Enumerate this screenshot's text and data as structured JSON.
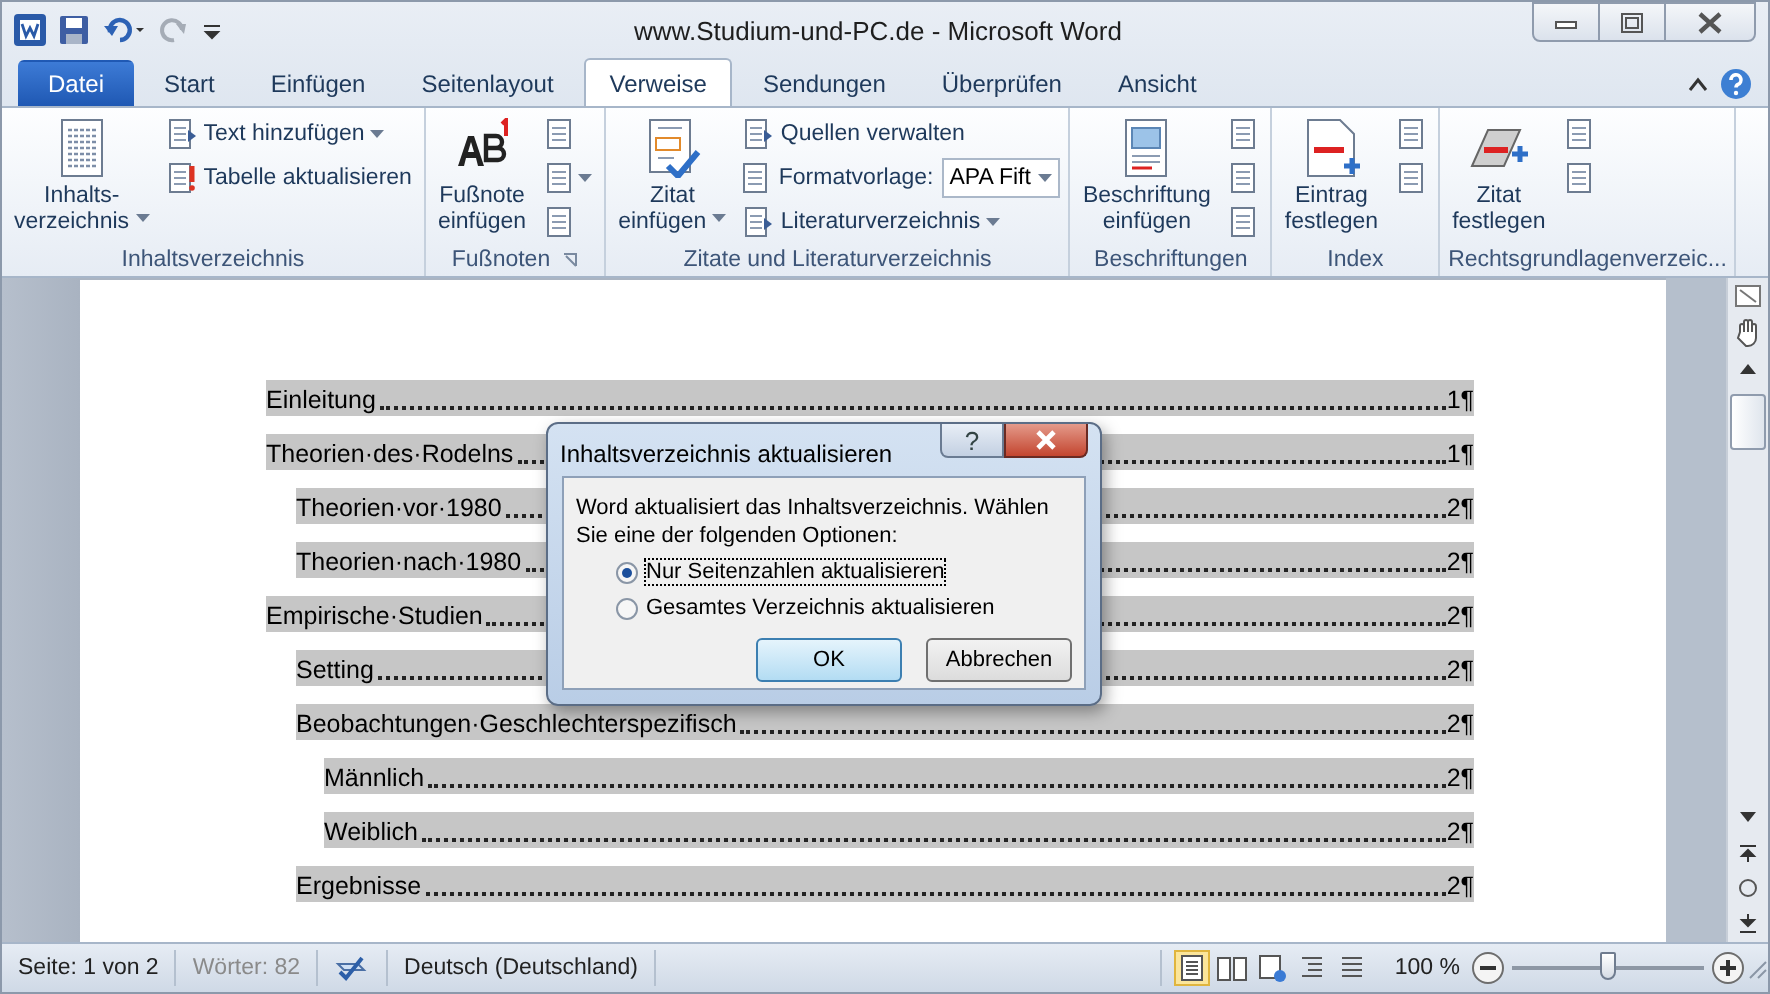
{
  "window": {
    "title": "www.Studium-und-PC.de - Microsoft Word"
  },
  "tabs": [
    {
      "label": "Datei",
      "kind": "file",
      "selected": false
    },
    {
      "label": "Start",
      "kind": "tab",
      "selected": false
    },
    {
      "label": "Einfügen",
      "kind": "tab",
      "selected": false
    },
    {
      "label": "Seitenlayout",
      "kind": "tab",
      "selected": false
    },
    {
      "label": "Verweise",
      "kind": "tab",
      "selected": true
    },
    {
      "label": "Sendungen",
      "kind": "tab",
      "selected": false
    },
    {
      "label": "Überprüfen",
      "kind": "tab",
      "selected": false
    },
    {
      "label": "Ansicht",
      "kind": "tab",
      "selected": false
    }
  ],
  "ribbon_groups": [
    {
      "label": "Inhaltsverzeichnis",
      "launcher": false,
      "columns": [
        {
          "kind": "large",
          "lines": [
            "Inhalts-",
            "verzeichnis"
          ],
          "dropdown": true
        },
        {
          "kind": "stack",
          "items": [
            {
              "kind": "small",
              "label": "Text hinzufügen",
              "dropdown": true
            },
            {
              "kind": "small",
              "label": "Tabelle aktualisieren",
              "dropdown": false
            }
          ]
        }
      ]
    },
    {
      "label": "Fußnoten",
      "launcher": true,
      "columns": [
        {
          "kind": "large",
          "lines": [
            "Fußnote",
            "einfügen"
          ],
          "dropdown": false
        },
        {
          "kind": "stack",
          "items": [
            {
              "kind": "icon",
              "dropdown": false
            },
            {
              "kind": "icon",
              "dropdown": true
            },
            {
              "kind": "icon",
              "dropdown": false
            }
          ]
        }
      ]
    },
    {
      "label": "Zitate und Literaturverzeichnis",
      "launcher": false,
      "columns": [
        {
          "kind": "large",
          "lines": [
            "Zitat",
            "einfügen"
          ],
          "dropdown": true
        },
        {
          "kind": "stack",
          "items": [
            {
              "kind": "small",
              "label": "Quellen verwalten",
              "dropdown": false
            },
            {
              "kind": "combo",
              "label": "Formatvorlage:",
              "value": "APA Fift"
            },
            {
              "kind": "small",
              "label": "Literaturverzeichnis",
              "dropdown": true
            }
          ]
        }
      ]
    },
    {
      "label": "Beschriftungen",
      "launcher": false,
      "columns": [
        {
          "kind": "large",
          "lines": [
            "Beschriftung",
            "einfügen"
          ],
          "dropdown": false
        },
        {
          "kind": "stack",
          "items": [
            {
              "kind": "icon",
              "dropdown": false
            },
            {
              "kind": "icon",
              "dropdown": false
            },
            {
              "kind": "icon",
              "dropdown": false
            }
          ]
        }
      ]
    },
    {
      "label": "Index",
      "launcher": false,
      "columns": [
        {
          "kind": "large",
          "lines": [
            "Eintrag",
            "festlegen"
          ],
          "dropdown": false
        },
        {
          "kind": "stack",
          "items": [
            {
              "kind": "icon",
              "dropdown": false
            },
            {
              "kind": "icon",
              "dropdown": false
            }
          ]
        }
      ]
    },
    {
      "label": "Rechtsgrundlagenverzeic...",
      "launcher": false,
      "columns": [
        {
          "kind": "large",
          "lines": [
            "Zitat",
            "festlegen"
          ],
          "dropdown": false
        },
        {
          "kind": "stack",
          "items": [
            {
              "kind": "icon",
              "dropdown": false
            },
            {
              "kind": "icon",
              "dropdown": false
            }
          ]
        }
      ]
    }
  ],
  "toc": [
    {
      "title": "Einleitung",
      "page": "1¶"
    },
    {
      "title": "Theorien·des·Rodelns",
      "page": "1¶",
      "children": [
        {
          "title": "Theorien·vor·1980",
          "page": "2¶"
        },
        {
          "title": "Theorien·nach·1980",
          "page": "2¶"
        }
      ]
    },
    {
      "title": "Empirische·Studien",
      "page": "2¶",
      "children": [
        {
          "title": "Setting",
          "page": "2¶"
        },
        {
          "title": "Beobachtungen·Geschlechterspezifisch",
          "page": "2¶",
          "children": [
            {
              "title": "Männlich",
              "page": "2¶"
            },
            {
              "title": "Weiblich",
              "page": "2¶"
            }
          ]
        },
        {
          "title": "Ergebnisse",
          "page": "2¶"
        }
      ]
    }
  ],
  "dialog": {
    "title": "Inhaltsverzeichnis aktualisieren",
    "help": "?",
    "message": "Word aktualisiert das Inhaltsverzeichnis. Wählen Sie eine der folgenden Optionen:",
    "options": [
      {
        "label": "Nur Seitenzahlen aktualisieren",
        "selected": true
      },
      {
        "label": "Gesamtes Verzeichnis aktualisieren",
        "selected": false
      }
    ],
    "buttons": [
      {
        "label": "OK",
        "default": true
      },
      {
        "label": "Abbrechen",
        "default": false
      }
    ]
  },
  "status_bar": {
    "page": "Seite: 1 von 2",
    "words": "Wörter: 82",
    "words_disabled": true,
    "language": "Deutsch (Deutschland)",
    "views": [
      {
        "selected": true
      },
      {
        "selected": false
      },
      {
        "selected": false
      },
      {
        "selected": false
      },
      {
        "selected": false
      }
    ],
    "zoom": "100 %",
    "zoom_slider": {
      "level": 0.5
    }
  }
}
